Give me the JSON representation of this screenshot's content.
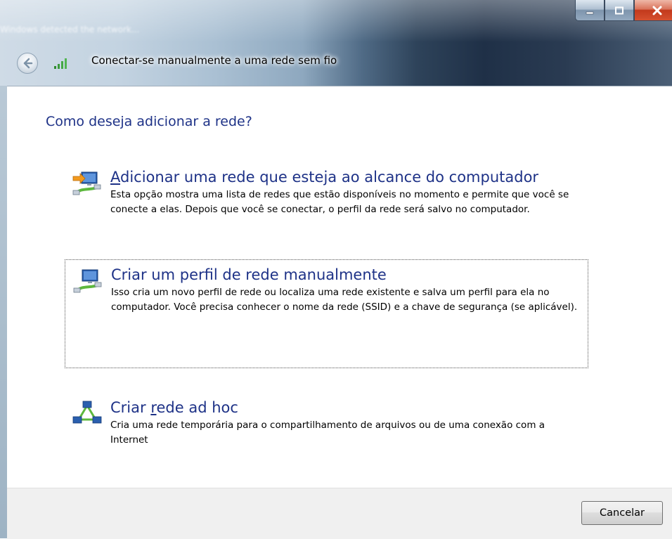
{
  "window": {
    "title": "Conectar-se manualmente a uma rede sem fio",
    "background_text_line1": "Windows detected the network...",
    "background_text_line2": ""
  },
  "heading": "Como deseja adicionar a rede?",
  "options": [
    {
      "title_accel": "A",
      "title_rest": "dicionar uma rede que esteja ao alcance do computador",
      "description": "Esta opção mostra uma lista de redes que estão disponíveis no momento e permite que você se conecte a elas. Depois que você se conectar, o perfil da rede será salvo no computador.",
      "icon": "network-add-icon"
    },
    {
      "title": "Criar um perfil de rede manualmente",
      "description": "Isso cria um novo perfil de rede ou localiza uma rede existente e salva um perfil para ela no computador. Você precisa conhecer o nome da rede (SSID) e a chave de segurança (se aplicável).",
      "icon": "network-profile-icon"
    },
    {
      "title_pre": "Criar ",
      "title_accel": "r",
      "title_post": "ede ad hoc",
      "description": "Cria uma rede temporária para o compartilhamento de arquivos ou de uma conexão com a Internet",
      "icon": "adhoc-network-icon"
    }
  ],
  "footer": {
    "cancel_label": "Cancelar"
  },
  "colors": {
    "heading": "#1e3287",
    "link_title": "#1e3287",
    "footer_bg": "#f0f0f0"
  }
}
